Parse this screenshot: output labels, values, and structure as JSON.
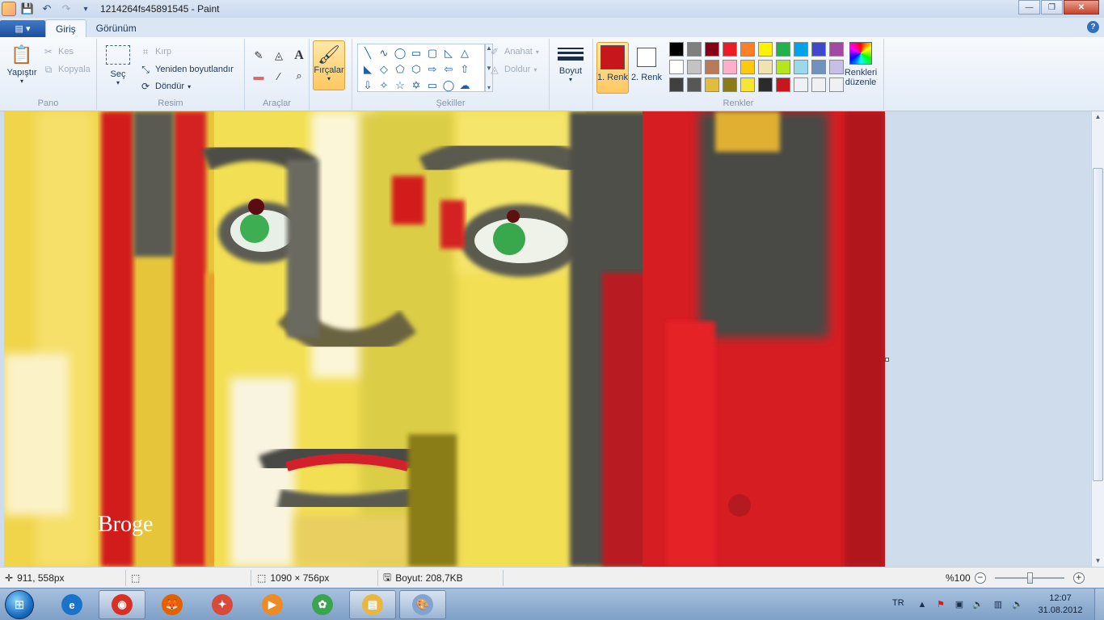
{
  "window": {
    "title": "1214264fs45891545 - Paint",
    "minimize": "—",
    "maximize": "❐",
    "close": "✕"
  },
  "qat": {
    "save": "💾",
    "undo": "↶",
    "redo": "↷",
    "dropdown": "▾"
  },
  "tabs": {
    "menu": "▤ ▾",
    "home": "Giriş",
    "view": "Görünüm",
    "help": "?"
  },
  "ribbon": {
    "clipboard": {
      "label": "Pano",
      "paste": "Yapıştır",
      "cut": "Kes",
      "copy": "Kopyala"
    },
    "image": {
      "label": "Resim",
      "select": "Seç",
      "crop": "Kırp",
      "resize": "Yeniden boyutlandır",
      "rotate": "Döndür"
    },
    "tools": {
      "label": "Araçlar"
    },
    "brushes": {
      "label": "Fırçalar"
    },
    "shapes": {
      "label": "Şekiller",
      "outline": "Anahat",
      "fill": "Doldur",
      "items": [
        "╲",
        "∿",
        "◯",
        "▭",
        "▢",
        "◺",
        "△",
        "◣",
        "◇",
        "⬠",
        "⬡",
        "⇨",
        "⇦",
        "⇧",
        "⇩",
        "✧",
        "☆",
        "✡",
        "▭",
        "◯",
        "☁"
      ]
    },
    "size": {
      "label": "Boyut"
    },
    "colors": {
      "label": "Renkler",
      "color1": "1. Renk",
      "color2": "2. Renk",
      "color1_value": "#c8161d",
      "color2_value": "#ffffff",
      "edit": "Renkleri düzenle",
      "palette": [
        "#000000",
        "#7f7f7f",
        "#880015",
        "#ed1c24",
        "#ff7f27",
        "#fff200",
        "#22b14c",
        "#00a2e8",
        "#3f48cc",
        "#a349a4",
        "#ffffff",
        "#c3c3c3",
        "#b97a57",
        "#ffaec9",
        "#ffc90e",
        "#efe4b0",
        "#b5e61d",
        "#99d9ea",
        "#7092be",
        "#c8bfe7",
        "#404040",
        "#575757",
        "#e0bd3c",
        "#8a7b18",
        "#f7e535",
        "#2b2b2b",
        "#c8161d",
        "#eef0f4",
        "#eef0f4",
        "#eef0f4"
      ]
    }
  },
  "canvas": {
    "signature": "Broge"
  },
  "statusbar": {
    "cursor_pos": "911, 558px",
    "image_size": "1090 × 756px",
    "file_size": "Boyut: 208,7KB",
    "zoom": "%100",
    "zoom_level": 0.5
  },
  "taskbar": {
    "start": "⊞",
    "apps": [
      {
        "name": "internet-explorer",
        "glyph": "e",
        "open": false,
        "color": "#1a73c9"
      },
      {
        "name": "chrome",
        "glyph": "◉",
        "open": true,
        "color": "#d93025"
      },
      {
        "name": "firefox",
        "glyph": "🦊",
        "open": false,
        "color": "#e66000"
      },
      {
        "name": "paint-tool",
        "glyph": "✦",
        "open": false,
        "color": "#d84a3a"
      },
      {
        "name": "media-player",
        "glyph": "▶",
        "open": false,
        "color": "#f08a24"
      },
      {
        "name": "messenger",
        "glyph": "✿",
        "open": false,
        "color": "#3aa54f"
      },
      {
        "name": "explorer",
        "glyph": "▤",
        "open": true,
        "color": "#e9b640"
      },
      {
        "name": "paint",
        "glyph": "🎨",
        "open": true,
        "color": "#7fa4d4"
      }
    ],
    "lang": "TR",
    "time": "12:07",
    "date": "31.08.2012"
  }
}
